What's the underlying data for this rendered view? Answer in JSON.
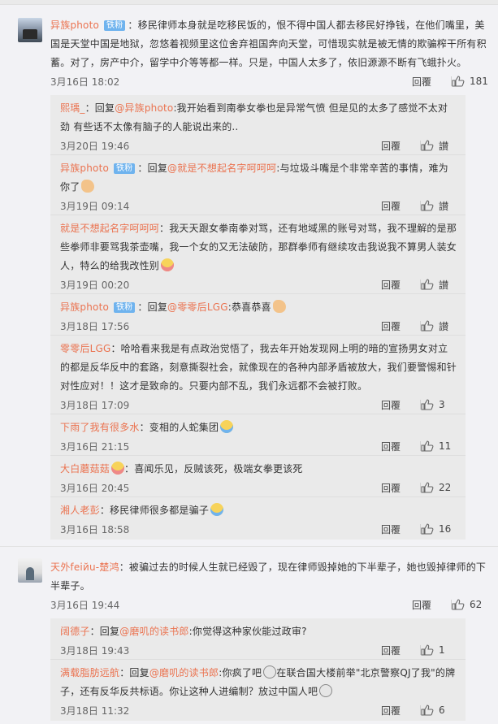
{
  "comments": [
    {
      "name": "异族photo",
      "badge": "铁粉",
      "text": "：移民律师本身就是吃移民饭的，恨不得中国人都去移民好挣钱，在他们嘴里，美国是天堂中国是地狱，忽悠着视频里这位舍弃祖国奔向天堂，可惜现实就是被无情的欺骗榨干所有积蓄。对了，房产中介，留学中介等等都一样。只是，中国人太多了，依旧源源不断有飞蛾扑火。",
      "time": "3月16日 18:02",
      "reply_label": "回覆",
      "likes": "181",
      "replies": [
        {
          "name": "熙瑀_",
          "prefix": "：回复",
          "at": "@异族photo",
          "text": ":我开始看到南拳女拳也是异常气愤 但是见的太多了感觉不太对劲 有些话不太像有脑子的人能说出来的..",
          "emoji": "",
          "time": "3月20日 19:46",
          "reply_label": "回覆",
          "likes": "讃"
        },
        {
          "name": "异族photo",
          "badge": "铁粉",
          "prefix": "：回复",
          "at": "@就是不想起名字呵呵呵",
          "text": ":与垃圾斗嘴是个非常辛苦的事情，难为你了",
          "emoji": "hand",
          "time": "3月19日 09:14",
          "reply_label": "回覆",
          "likes": "讃"
        },
        {
          "name": "就是不想起名字呵呵呵",
          "prefix": "",
          "at": "",
          "text": "：我天天跟女拳南拳对骂，还有地域黑的账号对骂，我不理解的是那些拳师非要骂我茶壶嘴，我一个女的又无法破防，那群拳师有继续攻击我说我不算男人装女人，特么的给我改性别",
          "emoji": "laugh",
          "time": "3月19日 00:20",
          "reply_label": "回覆",
          "likes": "讃"
        },
        {
          "name": "异族photo",
          "badge": "铁粉",
          "prefix": "：回复",
          "at": "@零零后LGG",
          "text": ":恭喜恭喜",
          "emoji": "hand",
          "time": "3月18日 17:56",
          "reply_label": "回覆",
          "likes": "讃"
        },
        {
          "name": "零零后LGG",
          "prefix": "",
          "at": "",
          "text": "：哈哈看来我是有点政治觉悟了，我去年开始发现网上明的暗的宣扬男女对立的都是反华反中的套路，刻意撕裂社会，就像现在的各种内部矛盾被放大，我们要警惕和针对性应对！！这才是致命的。只要内部不乱，我们永远都不会被打败。",
          "emoji": "",
          "time": "3月18日 17:09",
          "reply_label": "回覆",
          "likes": "3"
        },
        {
          "name": "下雨了我有很多水",
          "prefix": "",
          "at": "",
          "text": "：变相的人蛇集团",
          "emoji": "cry",
          "time": "3月16日 21:15",
          "reply_label": "回覆",
          "likes": "11"
        },
        {
          "name": "大白蘑菇菇",
          "prefix": "",
          "at": "",
          "text": "：喜闻乐见，反贼该死，极端女拳更该死",
          "emoji": "",
          "name_emoji": "laugh",
          "time": "3月16日 20:45",
          "reply_label": "回覆",
          "likes": "22"
        },
        {
          "name": "湘人老彭",
          "prefix": "",
          "at": "",
          "text": "：移民律师很多都是骗子",
          "emoji": "cry",
          "time": "3月16日 18:58",
          "reply_label": "回覆",
          "likes": "16"
        }
      ]
    },
    {
      "name": "天外feiйu-楚鸿",
      "badge": "",
      "text": "：被骗过去的时候人生就已经毁了，现在律师毁掉她的下半辈子，她也毁掉律师的下半辈子。",
      "time": "3月16日 19:44",
      "reply_label": "回覆",
      "likes": "62",
      "replies": [
        {
          "name": "阔德子",
          "prefix": "：回复",
          "at": "@磨叽的读书郎",
          "text": ":你觉得这种家伙能过政审?",
          "emoji": "",
          "time": "3月18日 19:43",
          "reply_label": "回覆",
          "likes": "1"
        },
        {
          "name": "满载脂肪远航",
          "prefix": "：回复",
          "at": "@磨叽的读书郎",
          "text": ":你疯了吧",
          "emoji": "shock",
          "text2": "在联合国大楼前举\"北京警察QJ了我\"的牌子，还有反华反共标语。你让这种人进编制？放过中国人吧",
          "emoji2": "shock",
          "time": "3月18日 11:32",
          "reply_label": "回覆",
          "likes": "6"
        }
      ]
    }
  ]
}
